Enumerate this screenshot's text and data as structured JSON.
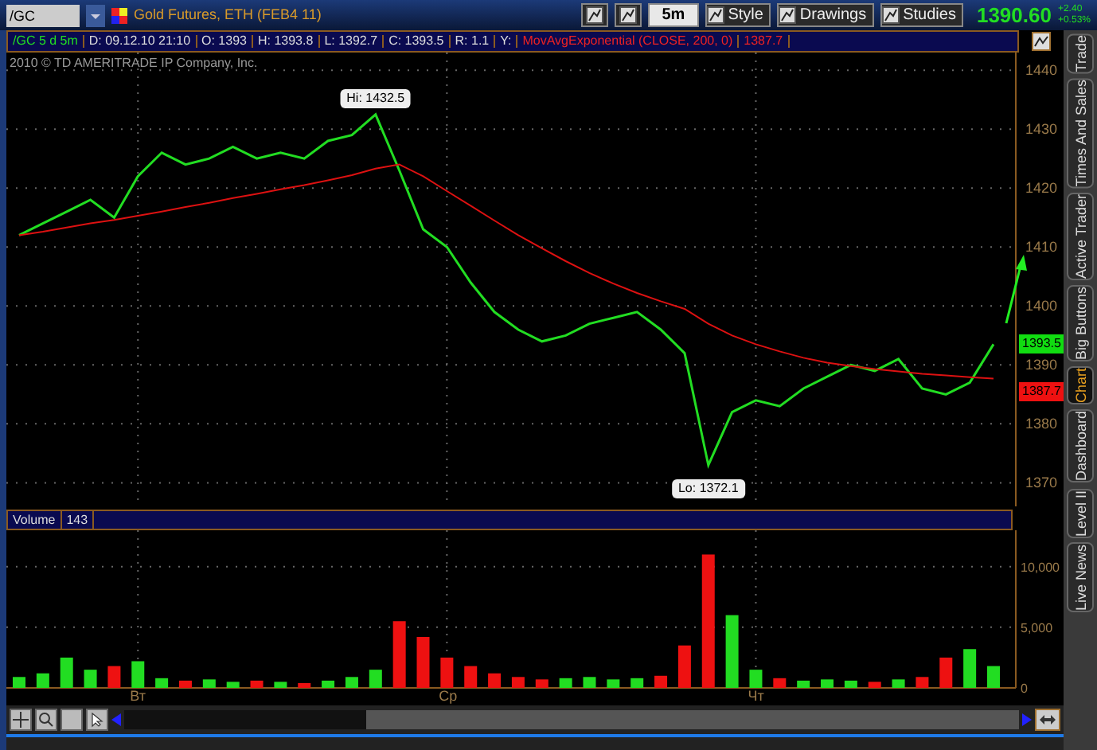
{
  "toolbar": {
    "symbol": "/GC",
    "title": "Gold Futures, ETH (FEB4 11)",
    "buttons": [
      {
        "kind": "icon"
      },
      {
        "kind": "icon2"
      },
      {
        "kind": "text",
        "label": "5m"
      },
      {
        "kind": "style",
        "label": "Style"
      },
      {
        "kind": "drawings",
        "label": "Drawings"
      },
      {
        "kind": "studies",
        "label": "Studies"
      }
    ],
    "last": "1390.60",
    "change": "+2.40",
    "change_pct": "+0.53%"
  },
  "info_bar": {
    "symbol": "/GC 5 d 5m",
    "fields": [
      "D: 09.12.10 21:10",
      "O: 1393",
      "H: 1393.8",
      "L: 1392.7",
      "C: 1393.5",
      "R: 1.1",
      "Y:"
    ],
    "study": "MovAvgExponential (CLOSE, 200, 0)",
    "study_value": "1387.7"
  },
  "copyright": "2010 © TD AMERITRADE IP Company, Inc.",
  "price_chart": {
    "chart_data": {
      "type": "line",
      "grid": true,
      "categories": [
        null,
        null,
        null,
        null,
        null,
        null,
        null,
        null,
        null,
        null,
        null,
        null,
        null,
        null,
        null,
        null,
        null,
        null,
        null,
        null,
        null,
        null,
        null,
        null,
        null,
        null,
        null,
        null,
        null,
        null,
        null,
        null,
        null,
        null,
        null,
        null,
        null,
        null,
        null,
        null,
        null,
        null
      ],
      "ylim": [
        1366,
        1443
      ],
      "yticks": [
        1370,
        1380,
        1390,
        1400,
        1410,
        1420,
        1430,
        1440
      ],
      "series": [
        {
          "color": "#22dd22",
          "values": [
            1412,
            1414,
            1416,
            1418,
            1415,
            1422,
            1426,
            1424,
            1425,
            1427,
            1425,
            1426,
            1425,
            1428,
            1429,
            1432.5,
            1423,
            1413,
            1410,
            1404,
            1399,
            1396,
            1394,
            1395,
            1397,
            1398,
            1399,
            1396,
            1392,
            1373,
            1382,
            1384,
            1383,
            1386,
            1388,
            1390,
            1389,
            1391,
            1386,
            1385,
            1387,
            1393.5
          ]
        },
        {
          "color": "#dd1111",
          "values": [
            1412,
            1412.6,
            1413.3,
            1414,
            1414.6,
            1415.3,
            1416,
            1416.8,
            1417.5,
            1418.3,
            1419,
            1419.8,
            1420.5,
            1421.3,
            1422.2,
            1423.3,
            1424,
            1422,
            1419.5,
            1417,
            1414.5,
            1412,
            1409.8,
            1407.6,
            1405.6,
            1403.8,
            1402.2,
            1400.8,
            1399.5,
            1397,
            1395,
            1393.5,
            1392.3,
            1391.2,
            1390.4,
            1389.8,
            1389.3,
            1388.9,
            1388.5,
            1388.2,
            1387.9,
            1387.7
          ]
        }
      ],
      "annotations": [
        {
          "text": "Hi: 1432.5",
          "y": 1432.5
        },
        {
          "text": "Lo: 1372.1",
          "y": 1372.1
        }
      ]
    },
    "last_badge": "1393.5",
    "ma_badge": "1387.7"
  },
  "volume_panel": {
    "label": "Volume",
    "value": "143",
    "chart_data": {
      "type": "bar",
      "grid": true,
      "categories": [
        null,
        null,
        null,
        null,
        null,
        "Вт",
        null,
        null,
        null,
        null,
        null,
        null,
        null,
        null,
        null,
        null,
        null,
        null,
        "Ср",
        null,
        null,
        null,
        null,
        null,
        null,
        null,
        null,
        null,
        null,
        null,
        null,
        "Чт",
        null,
        null,
        null,
        null,
        null,
        null,
        null,
        null,
        null,
        null
      ],
      "ylim": [
        0,
        13000
      ],
      "yticks": [
        {
          "value": 0,
          "label": "0"
        },
        {
          "value": 5000,
          "label": "5,000"
        },
        {
          "value": 10000,
          "label": "10,000"
        }
      ],
      "series": [
        {
          "color": "#22dd22",
          "values": [
            900,
            1200,
            2500,
            1500,
            0,
            2200,
            800,
            0,
            700,
            500,
            0,
            500,
            0,
            600,
            900,
            1500,
            0,
            0,
            0,
            0,
            0,
            0,
            0,
            800,
            900,
            700,
            800,
            0,
            0,
            0,
            6000,
            1500,
            0,
            600,
            700,
            600,
            0,
            700,
            0,
            0,
            3200,
            1800
          ]
        },
        {
          "color": "#ee1111",
          "values": [
            0,
            0,
            0,
            0,
            1800,
            0,
            0,
            600,
            0,
            0,
            600,
            0,
            400,
            0,
            0,
            0,
            5500,
            4200,
            2500,
            1800,
            1200,
            900,
            700,
            0,
            0,
            0,
            0,
            1000,
            3500,
            11000,
            0,
            0,
            800,
            0,
            0,
            0,
            500,
            0,
            900,
            2500,
            0,
            0
          ]
        }
      ],
      "stacked": true
    }
  },
  "side_tabs": [
    {
      "label": "Trade",
      "selected": false
    },
    {
      "label": "Times And Sales",
      "selected": false
    },
    {
      "label": "Active Trader",
      "selected": false
    },
    {
      "label": "Big Buttons",
      "selected": false
    },
    {
      "label": "Chart",
      "selected": true
    },
    {
      "label": "Dashboard",
      "selected": false
    },
    {
      "label": "Level II",
      "selected": false
    },
    {
      "label": "Live News",
      "selected": false
    }
  ]
}
